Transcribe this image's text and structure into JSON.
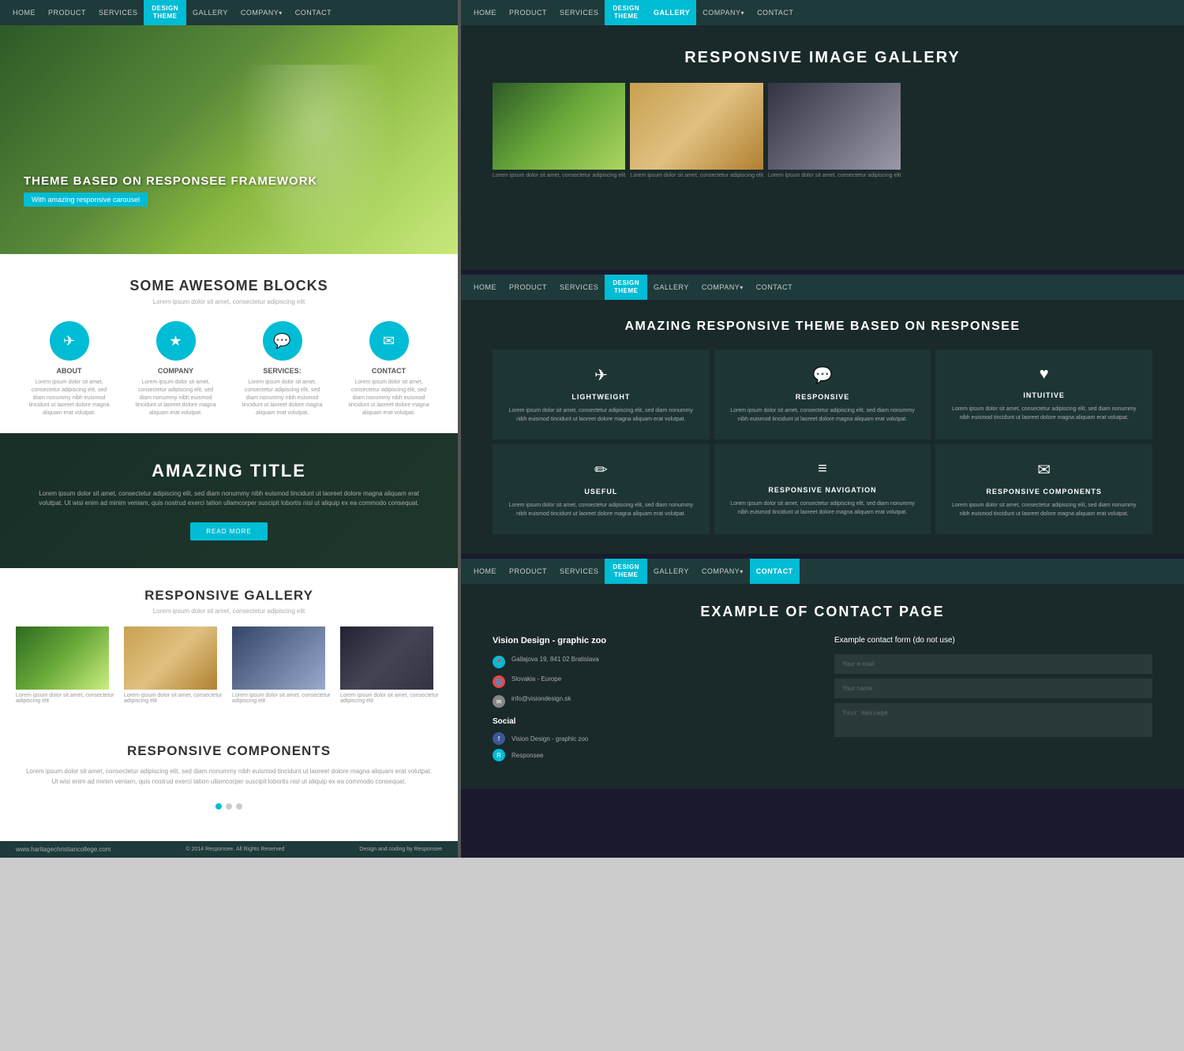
{
  "left": {
    "nav": {
      "items": [
        "HOME",
        "PRODUCT",
        "SERVICES",
        "DESIGN THEME",
        "GALLERY",
        "COMPANY",
        "CONTACT"
      ],
      "active": "DESIGN THEME"
    },
    "hero": {
      "title": "THEME BASED ON RESPONSEE FRAMEWORK",
      "subtitle": "With amazing responsive carousel"
    },
    "blocks": {
      "title": "SOME AWESOME BLOCKS",
      "subtitle": "Lorem ipsum dolor sit amet, consectetur adipiscing elit",
      "items": [
        {
          "icon": "✈",
          "label": "ABOUT",
          "text": "Lorem ipsum dolor sit amet, consectetur adipiscing elit, sed diam nonummy nibh euismod tincidunt ut laoreet dolore magna aliquam erat volutpat."
        },
        {
          "icon": "★",
          "label": "COMPANY",
          "text": "Lorem ipsum dolor sit amet, consectetur adipiscing elit, sed diam nonummy nibh euismod tincidunt ut laoreet dolore magna aliquam erat volutpat."
        },
        {
          "icon": "💬",
          "label": "SERVICES:",
          "text": "Lorem ipsum dolor sit amet, consectetur adipiscing elit, sed diam nonummy nibh euismod tincidunt ut laoreet dolore magna aliquam erat volutpat."
        },
        {
          "icon": "✉",
          "label": "CONTACT",
          "text": "Lorem ipsum dolor sit amet, consectetur adipiscing elit, sed diam nonummy nibh euismod tincidunt ut laoreet dolore magna aliquam erat volutpat."
        }
      ]
    },
    "cta": {
      "title": "AMAZING TITLE",
      "text": "Lorem ipsum dolor sit amet, consectetur adipiscing elit, sed diam nonummy nibh euismod tincidunt ut laoreet dolore magna aliquam erat volutpat. Ut wisi enim ad minim veniam, quis nostrud exerci tation ullamcorper suscipit lobortis nisl ut aliquip ex ea commodo consequat.",
      "button": "READ MORE"
    },
    "gallery": {
      "title": "RESPONSIVE GALLERY",
      "subtitle": "Lorem ipsum dolor sit amet, consectetur adipiscing elit",
      "images": [
        {
          "label": "Lorem ipsum dolor sit amet, consectetur adipiscing elit"
        },
        {
          "label": "Lorem ipsum dolor sit amet, consectetur adipiscing elit"
        },
        {
          "label": "Lorem ipsum dolor sit amet, consectetur adipiscing elit"
        },
        {
          "label": "Lorem ipsum dolor sit amet, consectetur adipiscing elit"
        }
      ]
    },
    "components": {
      "title": "RESPONSIVE COMPONENTS",
      "text": "Lorem ipsum dolor sit amet, consectetur adipiscing elit, sed diam nonummy nibh euismod tincidunt ut laoreet dolore magna aliquam erat volutpat. Ut wisi enim ad minim veniam, quis nostrud exerci tation ullamcorper suscipit lobortis nisl ut aliquip ex ea commodo consequat."
    },
    "footer": {
      "url": "www.haritagechristiancollege.com",
      "copy": "© 2014 Responsee. All Rights Reserved",
      "credit": "Design and coding by Responsee"
    }
  },
  "right": {
    "gallery_page": {
      "nav": {
        "items": [
          "HOME",
          "PRODUCT",
          "SERVICES",
          "DESIGN THEME",
          "GALLERY",
          "COMPANY",
          "CONTACT"
        ],
        "active": "GALLERY"
      },
      "title": "RESPONSIVE IMAGE GALLERY",
      "images_row1": [
        {
          "label": "Lorem ipsum dolor sit amet, consectetur adipiscing elit"
        },
        {
          "label": "Lorem ipsum dolor sit amet, consectetur adipiscing elit"
        },
        {
          "label": "Lorem ipsum dolor sit amet, consectetur adipiscing elit"
        }
      ],
      "images_row2": [
        {
          "label": ""
        },
        {
          "label": ""
        },
        {
          "label": ""
        }
      ]
    },
    "features_page": {
      "nav": {
        "items": [
          "HOME",
          "PRODUCT",
          "SERVICES",
          "DESIGN THEME",
          "GALLERY",
          "COMPANY",
          "CONTACT"
        ],
        "active": "DESIGN THEME"
      },
      "title": "AMAZING RESPONSIVE THEME BASED ON RESPONSEE",
      "features": [
        {
          "icon": "✈",
          "label": "LIGHTWEIGHT",
          "text": "Lorem ipsum dolor sit amet, consectetur adipiscing elit, sed diam nonummy nibh euismod tincidunt ut laoreet dolore magna aliquam erat volutpat."
        },
        {
          "icon": "💬",
          "label": "RESPONSIVE",
          "text": "Lorem ipsum dolor sit amet, consectetur adipiscing elit, sed diam nonummy nibh euismod tincidunt ut laoreet dolore magna aliquam erat volutpat."
        },
        {
          "icon": "♥",
          "label": "INTUITIVE",
          "text": "Lorem ipsum dolor sit amet, consectetur adipiscing elit, sed diam nonummy nibh euismod tincidunt ut laoreet dolore magna aliquam erat volutpat."
        },
        {
          "icon": "✏",
          "label": "USEFUL",
          "text": "Lorem ipsum dolor sit amet, consectetur adipiscing elit, sed diam nonummy nibh euismod tincidunt ut laoreet dolore magna aliquam erat volutpat."
        },
        {
          "icon": "≡",
          "label": "RESPONSIVE NAVIGATION",
          "text": "Lorem ipsum dolor sit amet, consectetur adipiscing elit, sed diam nonummy nibh euismod tincidunt ut laoreet dolore magna aliquam erat volutpat."
        },
        {
          "icon": "✉",
          "label": "RESPONSIVE COMPONENTS",
          "text": "Lorem ipsum dolor sit amet, consectetur adipiscing elit, sed diam nonummy nibh euismod tincidunt ut laoreet dolore magna aliquam erat volutpat."
        }
      ]
    },
    "contact_page": {
      "nav": {
        "items": [
          "HOME",
          "PRODUCT",
          "SERVICES",
          "DESIGN THEME",
          "GALLERY",
          "COMPANY",
          "CONTACT"
        ],
        "active": "CONTACT"
      },
      "title": "EXAMPLE OF CONTACT PAGE",
      "company_name": "Vision Design - graphic zoo",
      "address": "Gallajova 19, 841 02 Bratislava",
      "region": "Slovakia - Europe",
      "email": "info@visiondesign.sk",
      "social_title": "Social",
      "social_items": [
        {
          "label": "Vision Design - graphic zoo"
        },
        {
          "label": "Responsee"
        }
      ],
      "form_title": "Example contact form (do not use)",
      "form_fields": [
        "Your e-mail",
        "Your name",
        "Your massage"
      ]
    }
  }
}
